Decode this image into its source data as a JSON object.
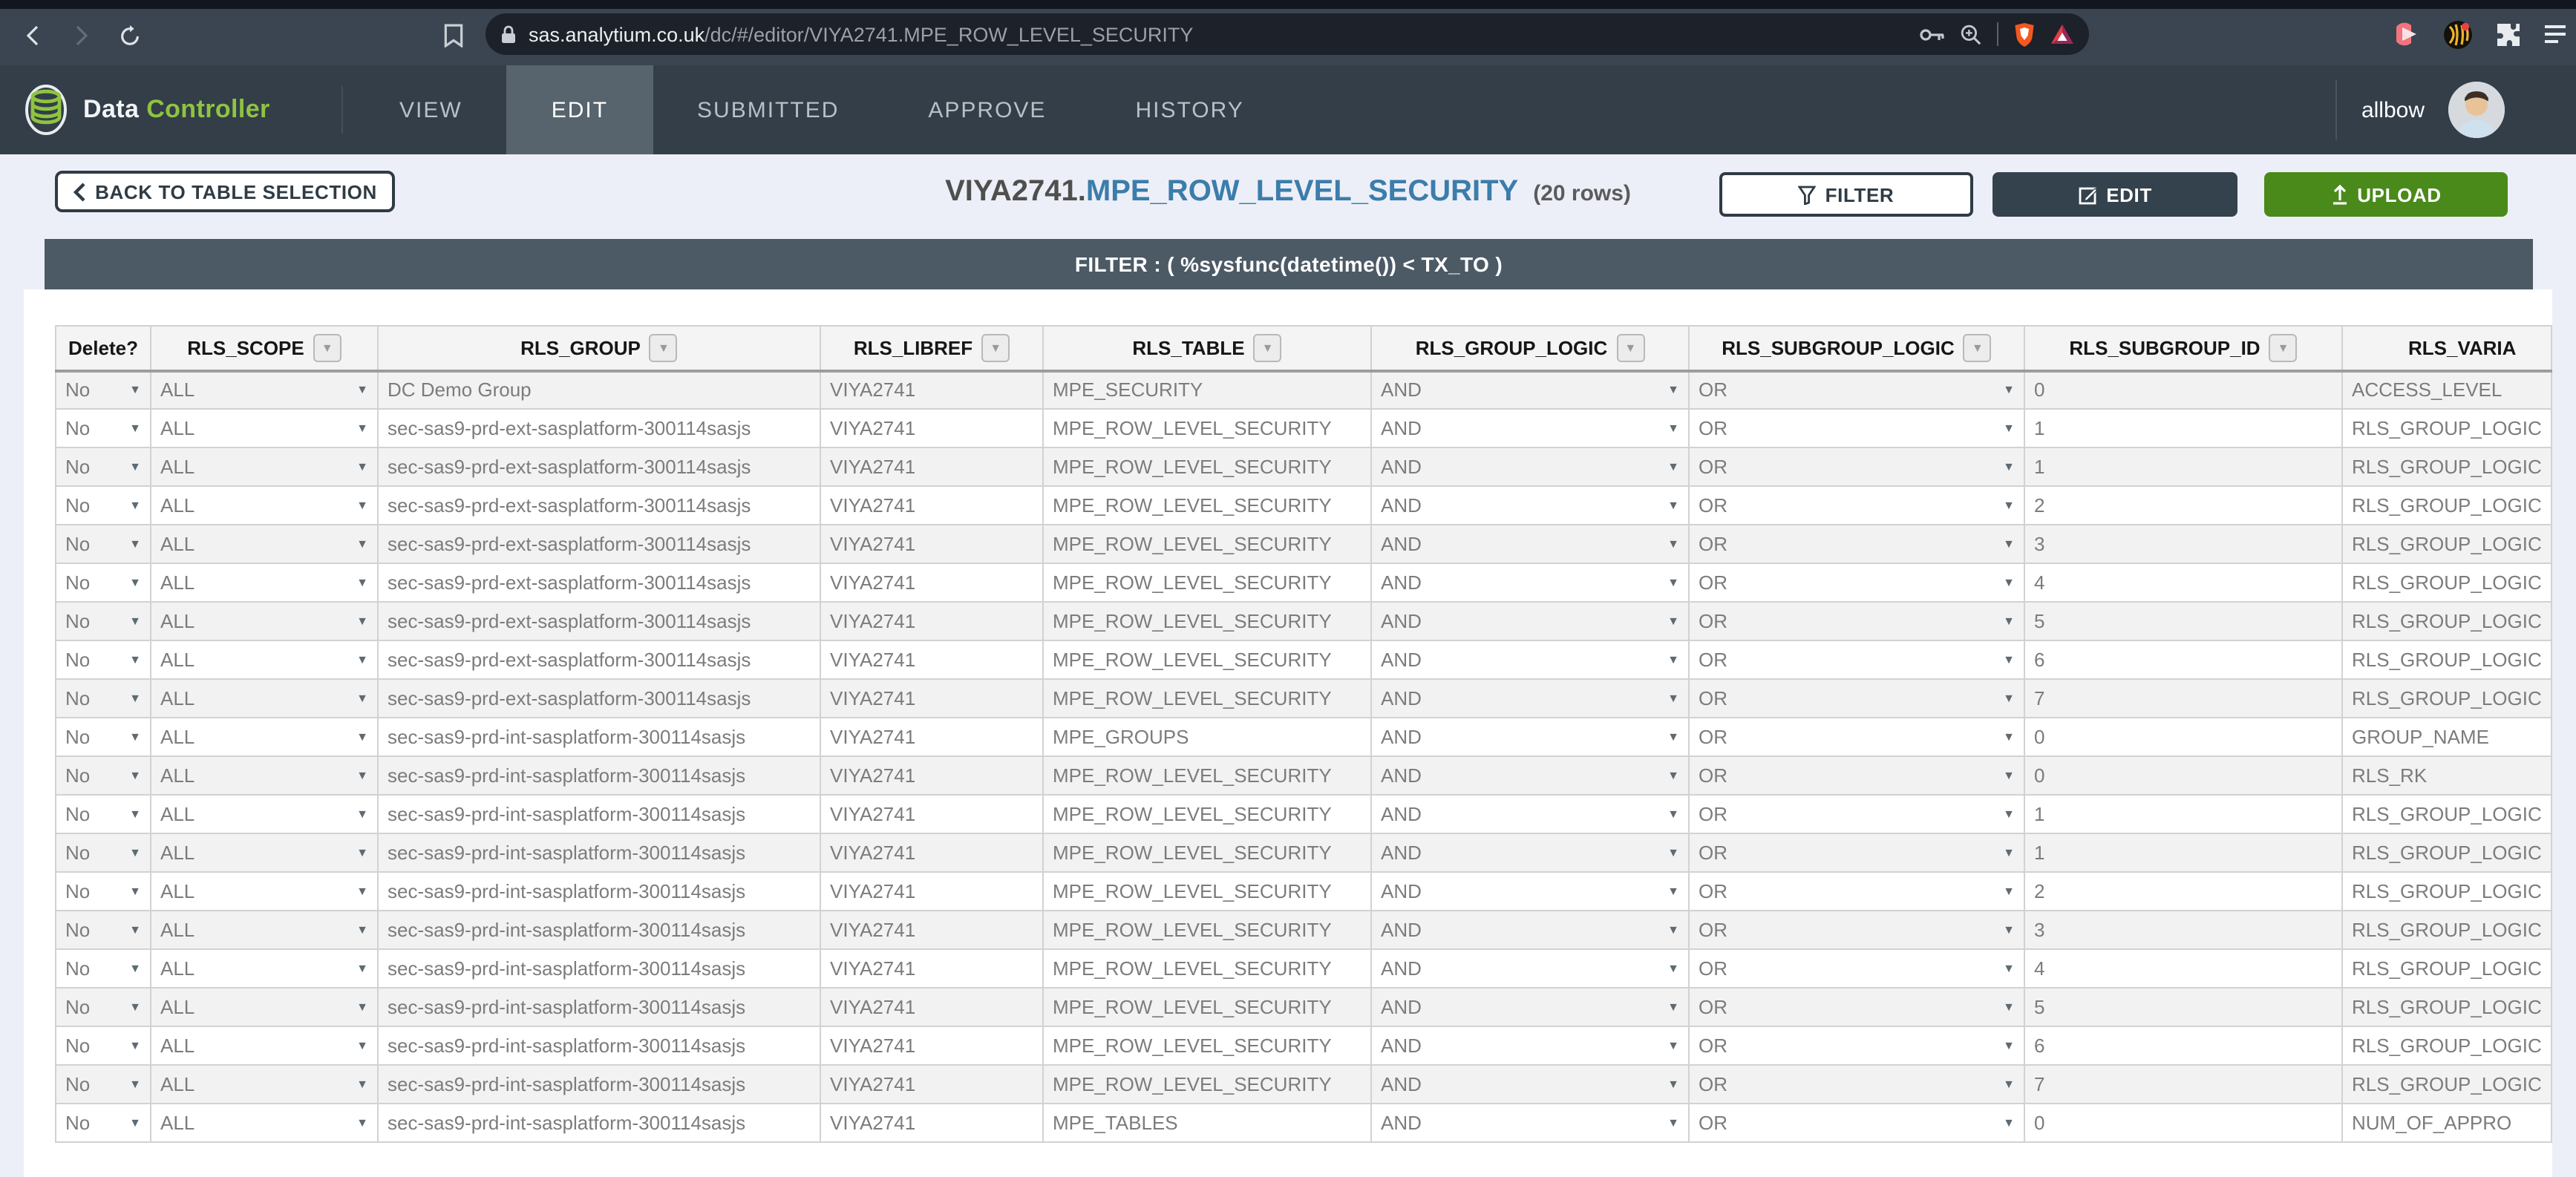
{
  "browser": {
    "url_host": "sas.analytium.co.uk",
    "url_path": "/dc/#/editor/VIYA2741.MPE_ROW_LEVEL_SECURITY",
    "icons": [
      "back",
      "forward",
      "reload",
      "bookmark",
      "lock",
      "key",
      "zoom-in",
      "brave-shield",
      "bat-triangle",
      "media-extension",
      "extension-badge",
      "puzzle",
      "menu"
    ]
  },
  "navbar": {
    "brand_first": "Data",
    "brand_second": "Controller",
    "tabs": [
      {
        "label": "VIEW",
        "active": false
      },
      {
        "label": "EDIT",
        "active": true
      },
      {
        "label": "SUBMITTED",
        "active": false
      },
      {
        "label": "APPROVE",
        "active": false
      },
      {
        "label": "HISTORY",
        "active": false
      }
    ],
    "username": "allbow"
  },
  "header": {
    "back_label": "BACK TO TABLE SELECTION",
    "title_libref": "VIYA2741.",
    "title_table": "MPE_ROW_LEVEL_SECURITY",
    "title_rows": "(20 rows)",
    "filter_label": "FILTER",
    "edit_label": "EDIT",
    "upload_label": "UPLOAD"
  },
  "filter_bar": {
    "text": "FILTER : ( %sysfunc(datetime()) < TX_TO )"
  },
  "colors": {
    "accent_green": "#4a8a1a",
    "brand_green": "#8fc43f",
    "title_blue": "#3b7dab",
    "dark_slate": "#34424d",
    "filterbar_bg": "#4c5a66"
  },
  "table": {
    "columns": [
      {
        "key": "delete",
        "label": "Delete?",
        "filter_icon": false,
        "dropdown": true
      },
      {
        "key": "scope",
        "label": "RLS_SCOPE",
        "filter_icon": true,
        "dropdown": true
      },
      {
        "key": "group",
        "label": "RLS_GROUP",
        "filter_icon": true,
        "dropdown": false
      },
      {
        "key": "libref",
        "label": "RLS_LIBREF",
        "filter_icon": true,
        "dropdown": false
      },
      {
        "key": "table",
        "label": "RLS_TABLE",
        "filter_icon": true,
        "dropdown": false
      },
      {
        "key": "logic",
        "label": "RLS_GROUP_LOGIC",
        "filter_icon": true,
        "dropdown": true
      },
      {
        "key": "sub_logic",
        "label": "RLS_SUBGROUP_LOGIC",
        "filter_icon": true,
        "dropdown": true
      },
      {
        "key": "sub_id",
        "label": "RLS_SUBGROUP_ID",
        "filter_icon": true,
        "dropdown": false
      },
      {
        "key": "variable",
        "label": "RLS_VARIA",
        "filter_icon": false,
        "dropdown": false
      }
    ],
    "rows": [
      {
        "delete": "No",
        "scope": "ALL",
        "group": "DC Demo Group",
        "libref": "VIYA2741",
        "table": "MPE_SECURITY",
        "logic": "AND",
        "sub_logic": "OR",
        "sub_id": "0",
        "variable": "ACCESS_LEVEL"
      },
      {
        "delete": "No",
        "scope": "ALL",
        "group": "sec-sas9-prd-ext-sasplatform-300114sasjs",
        "libref": "VIYA2741",
        "table": "MPE_ROW_LEVEL_SECURITY",
        "logic": "AND",
        "sub_logic": "OR",
        "sub_id": "1",
        "variable": "RLS_GROUP_LOGIC"
      },
      {
        "delete": "No",
        "scope": "ALL",
        "group": "sec-sas9-prd-ext-sasplatform-300114sasjs",
        "libref": "VIYA2741",
        "table": "MPE_ROW_LEVEL_SECURITY",
        "logic": "AND",
        "sub_logic": "OR",
        "sub_id": "1",
        "variable": "RLS_GROUP_LOGIC"
      },
      {
        "delete": "No",
        "scope": "ALL",
        "group": "sec-sas9-prd-ext-sasplatform-300114sasjs",
        "libref": "VIYA2741",
        "table": "MPE_ROW_LEVEL_SECURITY",
        "logic": "AND",
        "sub_logic": "OR",
        "sub_id": "2",
        "variable": "RLS_GROUP_LOGIC"
      },
      {
        "delete": "No",
        "scope": "ALL",
        "group": "sec-sas9-prd-ext-sasplatform-300114sasjs",
        "libref": "VIYA2741",
        "table": "MPE_ROW_LEVEL_SECURITY",
        "logic": "AND",
        "sub_logic": "OR",
        "sub_id": "3",
        "variable": "RLS_GROUP_LOGIC"
      },
      {
        "delete": "No",
        "scope": "ALL",
        "group": "sec-sas9-prd-ext-sasplatform-300114sasjs",
        "libref": "VIYA2741",
        "table": "MPE_ROW_LEVEL_SECURITY",
        "logic": "AND",
        "sub_logic": "OR",
        "sub_id": "4",
        "variable": "RLS_GROUP_LOGIC"
      },
      {
        "delete": "No",
        "scope": "ALL",
        "group": "sec-sas9-prd-ext-sasplatform-300114sasjs",
        "libref": "VIYA2741",
        "table": "MPE_ROW_LEVEL_SECURITY",
        "logic": "AND",
        "sub_logic": "OR",
        "sub_id": "5",
        "variable": "RLS_GROUP_LOGIC"
      },
      {
        "delete": "No",
        "scope": "ALL",
        "group": "sec-sas9-prd-ext-sasplatform-300114sasjs",
        "libref": "VIYA2741",
        "table": "MPE_ROW_LEVEL_SECURITY",
        "logic": "AND",
        "sub_logic": "OR",
        "sub_id": "6",
        "variable": "RLS_GROUP_LOGIC"
      },
      {
        "delete": "No",
        "scope": "ALL",
        "group": "sec-sas9-prd-ext-sasplatform-300114sasjs",
        "libref": "VIYA2741",
        "table": "MPE_ROW_LEVEL_SECURITY",
        "logic": "AND",
        "sub_logic": "OR",
        "sub_id": "7",
        "variable": "RLS_GROUP_LOGIC"
      },
      {
        "delete": "No",
        "scope": "ALL",
        "group": "sec-sas9-prd-int-sasplatform-300114sasjs",
        "libref": "VIYA2741",
        "table": "MPE_GROUPS",
        "logic": "AND",
        "sub_logic": "OR",
        "sub_id": "0",
        "variable": "GROUP_NAME"
      },
      {
        "delete": "No",
        "scope": "ALL",
        "group": "sec-sas9-prd-int-sasplatform-300114sasjs",
        "libref": "VIYA2741",
        "table": "MPE_ROW_LEVEL_SECURITY",
        "logic": "AND",
        "sub_logic": "OR",
        "sub_id": "0",
        "variable": "RLS_RK"
      },
      {
        "delete": "No",
        "scope": "ALL",
        "group": "sec-sas9-prd-int-sasplatform-300114sasjs",
        "libref": "VIYA2741",
        "table": "MPE_ROW_LEVEL_SECURITY",
        "logic": "AND",
        "sub_logic": "OR",
        "sub_id": "1",
        "variable": "RLS_GROUP_LOGIC"
      },
      {
        "delete": "No",
        "scope": "ALL",
        "group": "sec-sas9-prd-int-sasplatform-300114sasjs",
        "libref": "VIYA2741",
        "table": "MPE_ROW_LEVEL_SECURITY",
        "logic": "AND",
        "sub_logic": "OR",
        "sub_id": "1",
        "variable": "RLS_GROUP_LOGIC"
      },
      {
        "delete": "No",
        "scope": "ALL",
        "group": "sec-sas9-prd-int-sasplatform-300114sasjs",
        "libref": "VIYA2741",
        "table": "MPE_ROW_LEVEL_SECURITY",
        "logic": "AND",
        "sub_logic": "OR",
        "sub_id": "2",
        "variable": "RLS_GROUP_LOGIC"
      },
      {
        "delete": "No",
        "scope": "ALL",
        "group": "sec-sas9-prd-int-sasplatform-300114sasjs",
        "libref": "VIYA2741",
        "table": "MPE_ROW_LEVEL_SECURITY",
        "logic": "AND",
        "sub_logic": "OR",
        "sub_id": "3",
        "variable": "RLS_GROUP_LOGIC"
      },
      {
        "delete": "No",
        "scope": "ALL",
        "group": "sec-sas9-prd-int-sasplatform-300114sasjs",
        "libref": "VIYA2741",
        "table": "MPE_ROW_LEVEL_SECURITY",
        "logic": "AND",
        "sub_logic": "OR",
        "sub_id": "4",
        "variable": "RLS_GROUP_LOGIC"
      },
      {
        "delete": "No",
        "scope": "ALL",
        "group": "sec-sas9-prd-int-sasplatform-300114sasjs",
        "libref": "VIYA2741",
        "table": "MPE_ROW_LEVEL_SECURITY",
        "logic": "AND",
        "sub_logic": "OR",
        "sub_id": "5",
        "variable": "RLS_GROUP_LOGIC"
      },
      {
        "delete": "No",
        "scope": "ALL",
        "group": "sec-sas9-prd-int-sasplatform-300114sasjs",
        "libref": "VIYA2741",
        "table": "MPE_ROW_LEVEL_SECURITY",
        "logic": "AND",
        "sub_logic": "OR",
        "sub_id": "6",
        "variable": "RLS_GROUP_LOGIC"
      },
      {
        "delete": "No",
        "scope": "ALL",
        "group": "sec-sas9-prd-int-sasplatform-300114sasjs",
        "libref": "VIYA2741",
        "table": "MPE_ROW_LEVEL_SECURITY",
        "logic": "AND",
        "sub_logic": "OR",
        "sub_id": "7",
        "variable": "RLS_GROUP_LOGIC"
      },
      {
        "delete": "No",
        "scope": "ALL",
        "group": "sec-sas9-prd-int-sasplatform-300114sasjs",
        "libref": "VIYA2741",
        "table": "MPE_TABLES",
        "logic": "AND",
        "sub_logic": "OR",
        "sub_id": "0",
        "variable": "NUM_OF_APPRO"
      }
    ]
  }
}
